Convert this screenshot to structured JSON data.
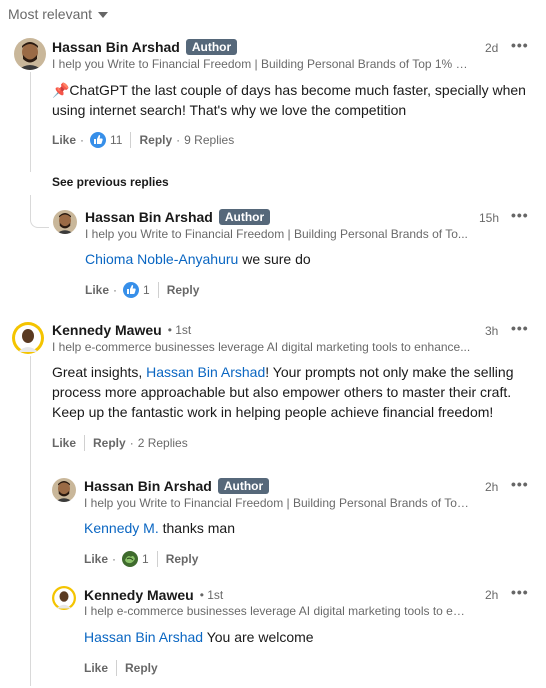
{
  "sort": {
    "label": "Most relevant"
  },
  "see_previous": "See previous replies",
  "comments": [
    {
      "name": "Hassan Bin Arshad",
      "badge": "Author",
      "headline": "I help you Write to Financial Freedom | Building Personal Brands of Top 1% C...",
      "time": "2d",
      "text": "📌ChatGPT the last couple of days has become much faster, specially when using internet search! That's why we love the competition",
      "like": "Like",
      "reaction_count": "11",
      "reply": "Reply",
      "replies": "9 Replies"
    },
    {
      "name": "Hassan Bin Arshad",
      "badge": "Author",
      "headline": "I help you Write to Financial Freedom | Building Personal Brands of To...",
      "time": "15h",
      "mention": "Chioma Noble-Anyahuru",
      "text": " we sure do",
      "like": "Like",
      "reaction_count": "1",
      "reply": "Reply"
    },
    {
      "name": "Kennedy Maweu",
      "degree": "1st",
      "headline": "I help e-commerce businesses leverage AI digital marketing tools to enhance...",
      "time": "3h",
      "text_before": "Great insights, ",
      "mention": "Hassan Bin Arshad",
      "text_after": "! Your prompts not only make the selling process more approachable but also empower others to master their craft. Keep up the fantastic work in helping people achieve financial freedom!",
      "like": "Like",
      "reply": "Reply",
      "replies": "2 Replies"
    },
    {
      "name": "Hassan Bin Arshad",
      "badge": "Author",
      "headline": "I help you Write to Financial Freedom | Building Personal Brands of Top...",
      "time": "2h",
      "mention": "Kennedy M.",
      "text": " thanks man",
      "like": "Like",
      "reaction_count": "1",
      "reply": "Reply"
    },
    {
      "name": "Kennedy Maweu",
      "degree": "1st",
      "headline": "I help e-commerce businesses leverage AI digital marketing tools to en...",
      "time": "2h",
      "mention": "Hassan Bin Arshad",
      "text": " You are welcome",
      "like": "Like",
      "reply": "Reply"
    }
  ],
  "icons": {
    "more": "more-options-icon",
    "like_reaction": "thumbs-up-reaction-icon",
    "support_reaction": "support-reaction-icon"
  },
  "colors": {
    "link": "#0a66c2",
    "badge": "#56687a",
    "like_blue": "#378fe9"
  }
}
